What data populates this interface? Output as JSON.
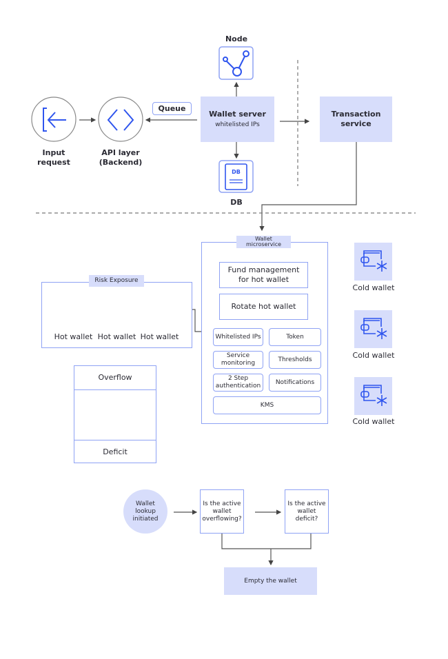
{
  "colors": {
    "accent": "#2f55ee",
    "fill": "#d7ddfb",
    "border": "#8ea2f4",
    "line": "#555555"
  },
  "top": {
    "input_request": {
      "label": "Input request",
      "icon": "login-arrow-icon"
    },
    "api_layer": {
      "label": "API layer (Backend)",
      "icon": "code-brackets-icon"
    },
    "queue": "Queue",
    "wallet_server": {
      "title": "Wallet server",
      "subtitle": "whitelisted IPs"
    },
    "node": {
      "label": "Node",
      "icon": "node-graph-icon"
    },
    "db": {
      "label": "DB",
      "icon_text": "DB"
    },
    "transaction_service": "Transaction service"
  },
  "microservice": {
    "title": "Wallet microservice",
    "fund_management": "Fund management for hot wallet",
    "rotate": "Rotate hot wallet",
    "features": [
      "Whitelisted IPs",
      "Token",
      "Service monitoring",
      "Thresholds",
      "2 Step authentication",
      "Notifications"
    ],
    "kms": "KMS"
  },
  "risk": {
    "title": "Risk Exposure",
    "hot_wallets": [
      "Hot wallet",
      "Hot wallet",
      "Hot wallet"
    ]
  },
  "cold_wallets": [
    "Cold wallet",
    "Cold wallet",
    "Cold wallet"
  ],
  "balance": {
    "overflow": "Overflow",
    "deficit": "Deficit"
  },
  "flow": {
    "start": "Wallet lookup initiated",
    "q1": "Is the active wallet overflowing?",
    "q2": "Is the active wallet deficit?",
    "end": "Empty the wallet"
  }
}
